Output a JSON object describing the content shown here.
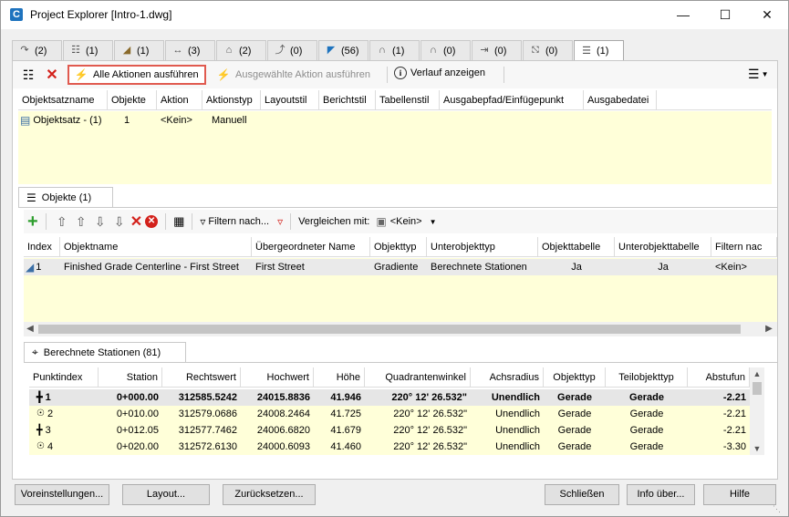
{
  "window": {
    "title": "Project Explorer [Intro-1.dwg]",
    "app_icon": "C"
  },
  "category_tabs": [
    {
      "icon": "alignment-icon",
      "count": "(2)"
    },
    {
      "icon": "corridor-icon",
      "count": "(1)"
    },
    {
      "icon": "surface-icon",
      "count": "(1)"
    },
    {
      "icon": "assembly-icon",
      "count": "(3)"
    },
    {
      "icon": "parcel-icon",
      "count": "(2)"
    },
    {
      "icon": "profile-icon",
      "count": "(0)"
    },
    {
      "icon": "pipe-network-icon",
      "count": "(56)"
    },
    {
      "icon": "pressure-network-icon",
      "count": "(1)"
    },
    {
      "icon": "structure-icon",
      "count": "(0)"
    },
    {
      "icon": "section-icon",
      "count": "(0)"
    },
    {
      "icon": "vehicle-icon",
      "count": "(0)"
    },
    {
      "icon": "objectset-icon",
      "count": "(1)"
    }
  ],
  "toolbar": {
    "run_all": "Alle Aktionen ausführen",
    "run_selected": "Ausgewählte Aktion ausführen",
    "history": "Verlauf anzeigen"
  },
  "objectset_table": {
    "headers": [
      "Objektsatzname",
      "Objekte",
      "Aktion",
      "Aktionstyp",
      "Layoutstil",
      "Berichtstil",
      "Tabellenstil",
      "Ausgabepfad/Einfügepunkt",
      "Ausgabedatei"
    ],
    "rows": [
      [
        "Objektsatz - (1)",
        "1",
        "<Kein>",
        "Manuell",
        "",
        "",
        "",
        "",
        ""
      ]
    ]
  },
  "objects_tab": {
    "label": "Objekte (1)"
  },
  "objects_toolbar": {
    "filter": "Filtern nach...",
    "compare_label": "Vergleichen mit:",
    "compare_value": "<Kein>"
  },
  "objects_table": {
    "headers": [
      "Index",
      "Objektname",
      "Übergeordneter Name",
      "Objekttyp",
      "Unterobjekttyp",
      "Objekttabelle",
      "Unterobjekttabelle",
      "Filtern nac"
    ],
    "rows": [
      [
        "1",
        "Finished Grade Centerline - First Street",
        "First Street",
        "Gradiente",
        "Berechnete Stationen",
        "Ja",
        "Ja",
        "<Kein>"
      ]
    ]
  },
  "stations_tab": {
    "label": "Berechnete Stationen (81)"
  },
  "stations_table": {
    "headers": [
      "Punktindex",
      "Station",
      "Rechtswert",
      "Hochwert",
      "Höhe",
      "Quadrantenwinkel",
      "Achsradius",
      "Objekttyp",
      "Teilobjekttyp",
      "Abstufun"
    ],
    "rows": [
      [
        "1",
        "0+000.00",
        "312585.5242",
        "24015.8836",
        "41.946",
        "220° 12' 26.532\"",
        "Unendlich",
        "Gerade",
        "Gerade",
        "-2.21"
      ],
      [
        "2",
        "0+010.00",
        "312579.0686",
        "24008.2464",
        "41.725",
        "220° 12' 26.532\"",
        "Unendlich",
        "Gerade",
        "Gerade",
        "-2.21"
      ],
      [
        "3",
        "0+012.05",
        "312577.7462",
        "24006.6820",
        "41.679",
        "220° 12' 26.532\"",
        "Unendlich",
        "Gerade",
        "Gerade",
        "-2.21"
      ],
      [
        "4",
        "0+020.00",
        "312572.6130",
        "24000.6093",
        "41.460",
        "220° 12' 26.532\"",
        "Unendlich",
        "Gerade",
        "Gerade",
        "-3.30"
      ]
    ]
  },
  "footer": {
    "presets": "Voreinstellungen...",
    "layout": "Layout...",
    "reset": "Zurücksetzen...",
    "close": "Schließen",
    "about": "Info über...",
    "help": "Hilfe"
  }
}
